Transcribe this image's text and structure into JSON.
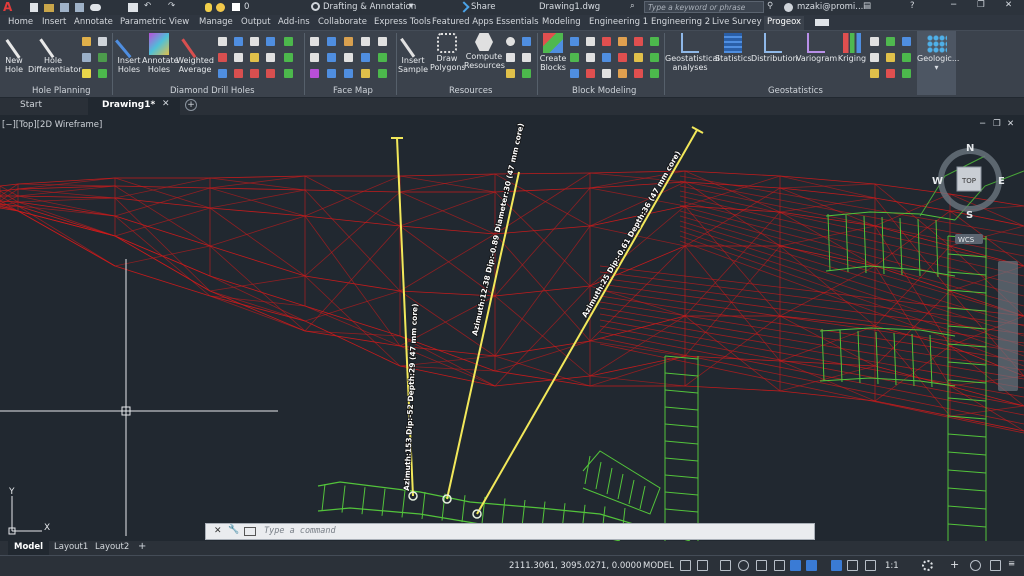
{
  "titlebar": {
    "app_letter": "A",
    "workspace": "Drafting & Annotation",
    "layer_value": "0",
    "share_label": "Share",
    "document_title": "Drawing1.dwg",
    "search_placeholder": "Type a keyword or phrase",
    "user_name": "mzaki@promi..."
  },
  "ribbon_tabs": [
    "Home",
    "Insert",
    "Annotate",
    "Parametric",
    "View",
    "Manage",
    "Output",
    "Add-ins",
    "Collaborate",
    "Express Tools",
    "Featured Apps",
    "Essentials",
    "Modeling",
    "Engineering 1",
    "Engineering 2",
    "Live Survey",
    "Progeox"
  ],
  "ribbon_active_tab": "Progeox",
  "panels": {
    "hole_planning": {
      "label": "Hole Planning",
      "tools": [
        {
          "line1": "New",
          "line2": "Hole"
        },
        {
          "line1": "Hole",
          "line2": "Differentiator"
        }
      ]
    },
    "diamond_drill_holes": {
      "label": "Diamond Drill Holes",
      "tools": [
        {
          "line1": "Insert",
          "line2": "Holes"
        },
        {
          "line1": "Annotate",
          "line2": "Holes"
        },
        {
          "line1": "Weighted",
          "line2": "Average"
        }
      ]
    },
    "face_map": {
      "label": "Face Map"
    },
    "resources": {
      "label": "Resources",
      "tools": [
        {
          "line1": "Insert",
          "line2": "Sample"
        },
        {
          "line1": "Draw",
          "line2": "Polygons"
        },
        {
          "line1": "Compute",
          "line2": "Resources"
        }
      ]
    },
    "block_modeling": {
      "label": "Block Modeling",
      "tools": [
        {
          "line1": "Create",
          "line2": "Blocks"
        }
      ]
    },
    "geostatistics": {
      "label": "Geostatistics",
      "tools": [
        {
          "line1": "Geostatistical",
          "line2": "analyses"
        },
        {
          "line1": "Statistics",
          "line2": ""
        },
        {
          "line1": "Distribution",
          "line2": ""
        },
        {
          "line1": "Variogram",
          "line2": ""
        },
        {
          "line1": "Kriging",
          "line2": ""
        },
        {
          "line1": "Geologic...",
          "line2": ""
        }
      ]
    }
  },
  "doc_tabs": {
    "start": "Start",
    "drawing": "Drawing1*"
  },
  "viewport": {
    "label": "[−][Top][2D Wireframe]",
    "viewcube": {
      "north": "N",
      "south": "S",
      "east": "E",
      "west": "W",
      "top": "TOP",
      "wcs": "WCS"
    },
    "ucs": {
      "x": "X",
      "y": "Y"
    },
    "hole_labels": [
      "Azimuth:153 Dip:-52 Depth:29 (47 mm core)",
      "Azimuth:12.38 Dip:-0.89 Diameter:30 (47 mm core)",
      "Azimuth:25 Dip:-0.61 Depth:36 (47 mm core)"
    ]
  },
  "command": {
    "placeholder": "Type a command"
  },
  "layouts": [
    "Model",
    "Layout1",
    "Layout2"
  ],
  "status": {
    "coords": "2111.3061, 3095.0271, 0.0000",
    "model": "MODEL",
    "scale": "1:1"
  },
  "colors": {
    "accent": "#3a7bd5",
    "section_red": "#d41a1a",
    "drift_green": "#53c43b",
    "hole_yellow": "#f2e85a"
  }
}
